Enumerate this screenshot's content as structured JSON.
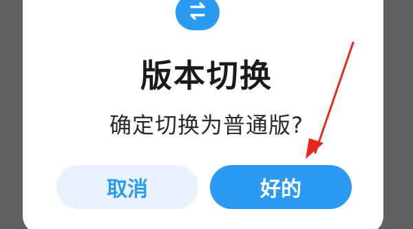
{
  "dialog": {
    "icon": "switch-arrows-icon",
    "title": "版本切换",
    "message": "确定切换为普通版?",
    "buttons": {
      "cancel_label": "取消",
      "ok_label": "好的"
    }
  },
  "colors": {
    "accent": "#2b9af3",
    "cancel_bg": "#e7f2fd",
    "annotation_arrow": "#e8261c",
    "backdrop": "#5f5f5f"
  }
}
